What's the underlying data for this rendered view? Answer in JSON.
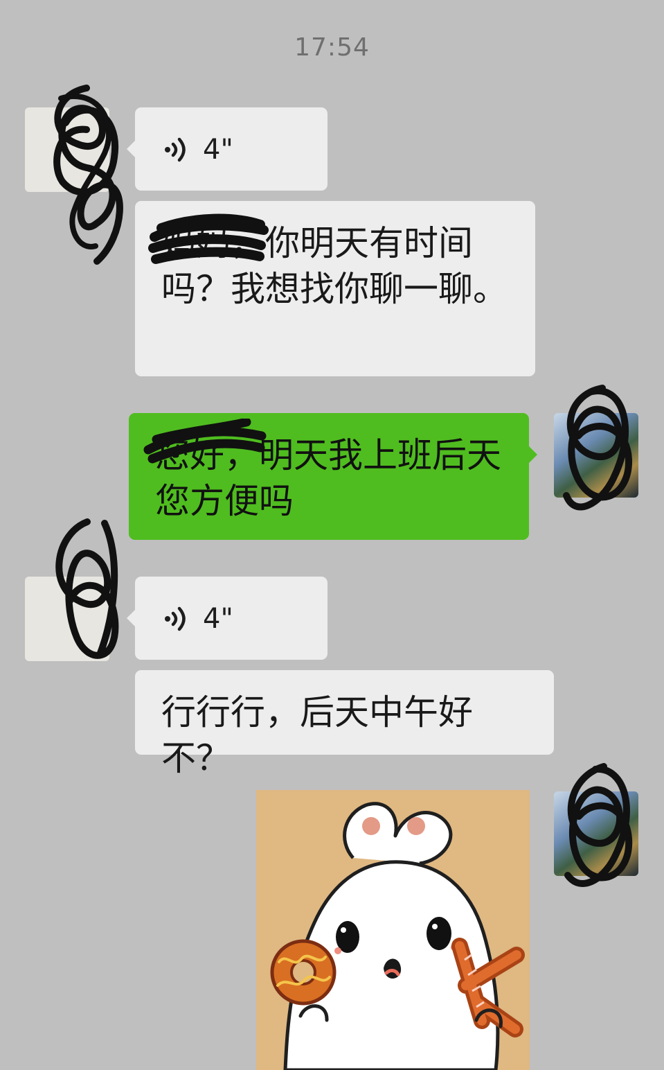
{
  "timestamp": "17:54",
  "messages": [
    {
      "type": "voice",
      "duration": "4\"",
      "icon": "voice-wave-icon"
    },
    {
      "type": "text",
      "text": "妈妈，你明天有时间吗？我想找你聊一聊。"
    },
    {
      "type": "text",
      "text": "您好，明天我上班后天您方便吗"
    },
    {
      "type": "voice",
      "duration": "4\"",
      "icon": "voice-wave-icon"
    },
    {
      "type": "text",
      "text": "行行行，后天中午好不？"
    },
    {
      "type": "sticker",
      "sticker": "bunny-ok-sticker"
    }
  ],
  "colors": {
    "background": "#bfbfbf",
    "incoming_bubble": "#ededed",
    "outgoing_bubble": "#4fbd1f",
    "timestamp": "#6f6f6f"
  }
}
